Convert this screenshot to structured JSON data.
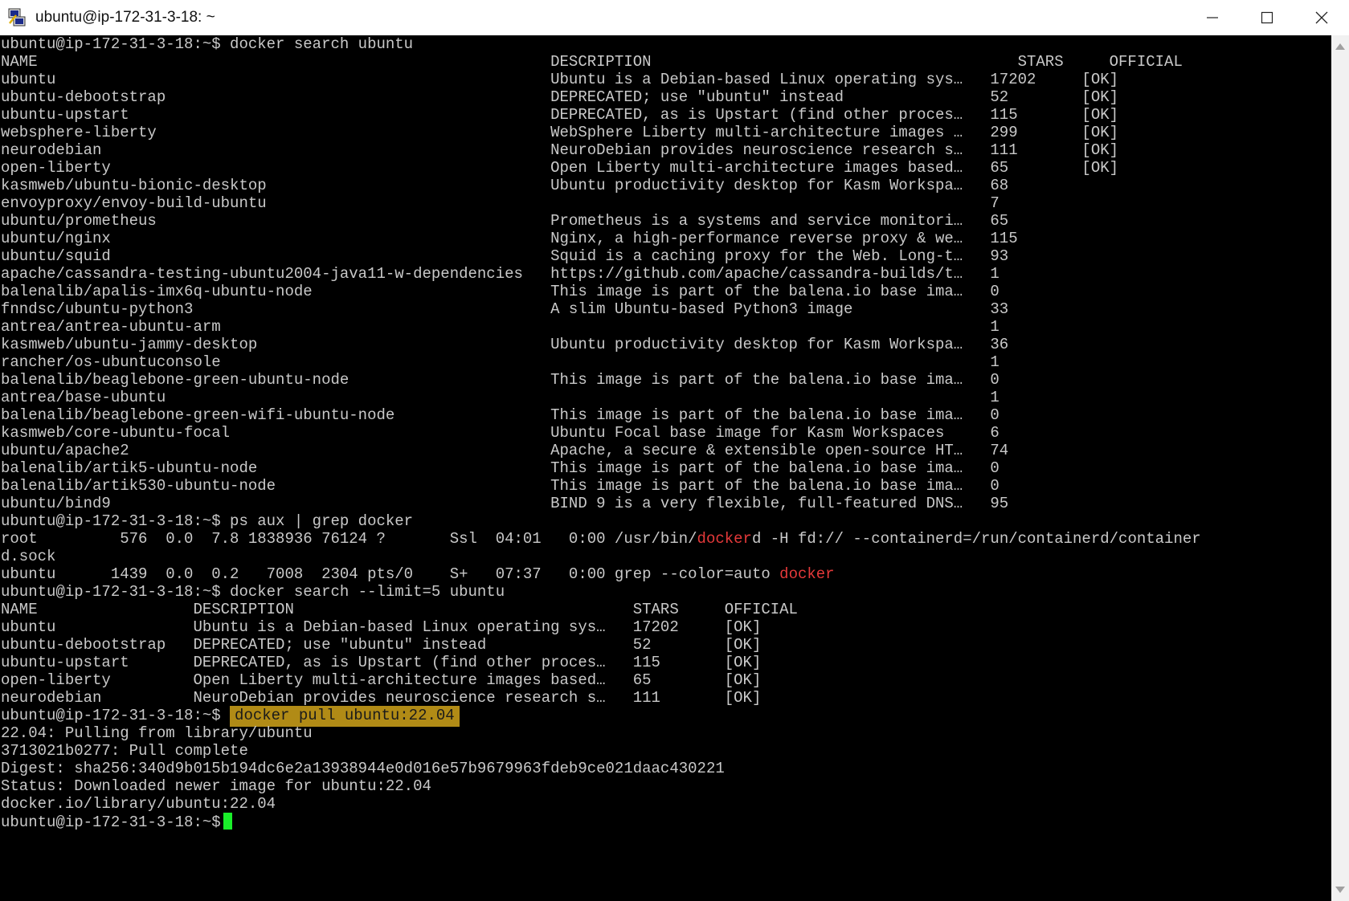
{
  "window": {
    "title": "ubuntu@ip-172-31-3-18: ~"
  },
  "icons": {
    "app": "putty-icon",
    "minimize": "minimize-icon",
    "maximize": "maximize-icon",
    "close": "close-icon"
  },
  "colors": {
    "terminal_bg": "#000000",
    "terminal_fg": "#c9c9c9",
    "match_highlight": "#e5393a",
    "selection_bg": "#b18b16",
    "cursor": "#1aef2a"
  },
  "terminal": {
    "lines": [
      [
        {
          "t": "ubuntu@ip-172-31-3-18:~$ docker search ubuntu"
        }
      ],
      [
        {
          "t": "NAME                                                        DESCRIPTION                                        STARS     OFFICIAL"
        }
      ],
      [
        {
          "t": "ubuntu                                                      Ubuntu is a Debian-based Linux operating sys…   17202     [OK]"
        }
      ],
      [
        {
          "t": "ubuntu-debootstrap                                          DEPRECATED; use \"ubuntu\" instead                52        [OK]"
        }
      ],
      [
        {
          "t": "ubuntu-upstart                                              DEPRECATED, as is Upstart (find other proces…   115       [OK]"
        }
      ],
      [
        {
          "t": "websphere-liberty                                           WebSphere Liberty multi-architecture images …   299       [OK]"
        }
      ],
      [
        {
          "t": "neurodebian                                                 NeuroDebian provides neuroscience research s…   111       [OK]"
        }
      ],
      [
        {
          "t": "open-liberty                                                Open Liberty multi-architecture images based…   65        [OK]"
        }
      ],
      [
        {
          "t": "kasmweb/ubuntu-bionic-desktop                               Ubuntu productivity desktop for Kasm Workspa…   68"
        }
      ],
      [
        {
          "t": "envoyproxy/envoy-build-ubuntu                                                                               7"
        }
      ],
      [
        {
          "t": "ubuntu/prometheus                                           Prometheus is a systems and service monitori…   65"
        }
      ],
      [
        {
          "t": "ubuntu/nginx                                                Nginx, a high-performance reverse proxy & we…   115"
        }
      ],
      [
        {
          "t": "ubuntu/squid                                                Squid is a caching proxy for the Web. Long-t…   93"
        }
      ],
      [
        {
          "t": "apache/cassandra-testing-ubuntu2004-java11-w-dependencies   https://github.com/apache/cassandra-builds/t…   1"
        }
      ],
      [
        {
          "t": "balenalib/apalis-imx6q-ubuntu-node                          This image is part of the balena.io base ima…   0"
        }
      ],
      [
        {
          "t": "fnndsc/ubuntu-python3                                       A slim Ubuntu-based Python3 image               33"
        }
      ],
      [
        {
          "t": "antrea/antrea-ubuntu-arm                                                                                    1"
        }
      ],
      [
        {
          "t": "kasmweb/ubuntu-jammy-desktop                                Ubuntu productivity desktop for Kasm Workspa…   36"
        }
      ],
      [
        {
          "t": "rancher/os-ubuntuconsole                                                                                    1"
        }
      ],
      [
        {
          "t": "balenalib/beaglebone-green-ubuntu-node                      This image is part of the balena.io base ima…   0"
        }
      ],
      [
        {
          "t": "antrea/base-ubuntu                                                                                          1"
        }
      ],
      [
        {
          "t": "balenalib/beaglebone-green-wifi-ubuntu-node                 This image is part of the balena.io base ima…   0"
        }
      ],
      [
        {
          "t": "kasmweb/core-ubuntu-focal                                   Ubuntu Focal base image for Kasm Workspaces     6"
        }
      ],
      [
        {
          "t": "ubuntu/apache2                                              Apache, a secure & extensible open-source HT…   74"
        }
      ],
      [
        {
          "t": "balenalib/artik5-ubuntu-node                                This image is part of the balena.io base ima…   0"
        }
      ],
      [
        {
          "t": "balenalib/artik530-ubuntu-node                              This image is part of the balena.io base ima…   0"
        }
      ],
      [
        {
          "t": "ubuntu/bind9                                                BIND 9 is a very flexible, full-featured DNS…   95"
        }
      ],
      [
        {
          "t": "ubuntu@ip-172-31-3-18:~$ ps aux | grep docker"
        }
      ],
      [
        {
          "t": "root         576  0.0  7.8 1838936 76124 ?       Ssl  04:01   0:00 /usr/bin/"
        },
        {
          "t": "docker",
          "c": "red"
        },
        {
          "t": "d -H fd:// --containerd=/run/containerd/container"
        }
      ],
      [
        {
          "t": "d.sock"
        }
      ],
      [
        {
          "t": "ubuntu      1439  0.0  0.2   7008  2304 pts/0    S+   07:37   0:00 grep --color=auto "
        },
        {
          "t": "docker",
          "c": "red"
        }
      ],
      [
        {
          "t": "ubuntu@ip-172-31-3-18:~$ docker search --limit=5 ubuntu"
        }
      ],
      [
        {
          "t": "NAME                 DESCRIPTION                                     STARS     OFFICIAL"
        }
      ],
      [
        {
          "t": "ubuntu               Ubuntu is a Debian-based Linux operating sys…   17202     [OK]"
        }
      ],
      [
        {
          "t": "ubuntu-debootstrap   DEPRECATED; use \"ubuntu\" instead                52        [OK]"
        }
      ],
      [
        {
          "t": "ubuntu-upstart       DEPRECATED, as is Upstart (find other proces…   115       [OK]"
        }
      ],
      [
        {
          "t": "open-liberty         Open Liberty multi-architecture images based…   65        [OK]"
        }
      ],
      [
        {
          "t": "neurodebian          NeuroDebian provides neuroscience research s…   111       [OK]"
        }
      ],
      [
        {
          "t": "ubuntu@ip-172-31-3-18:~$ "
        },
        {
          "t": "docker pull ubuntu:22.04",
          "c": "sel"
        }
      ],
      [
        {
          "t": "22.04: Pulling from library/ubuntu"
        }
      ],
      [
        {
          "t": "3713021b0277: Pull complete"
        }
      ],
      [
        {
          "t": "Digest: sha256:340d9b015b194dc6e2a13938944e0d016e57b9679963fdeb9ce021daac430221"
        }
      ],
      [
        {
          "t": "Status: Downloaded newer image for ubuntu:22.04"
        }
      ],
      [
        {
          "t": "docker.io/library/ubuntu:22.04"
        }
      ],
      [
        {
          "t": "ubuntu@ip-172-31-3-18:~$"
        },
        {
          "t": "",
          "c": "cursor"
        }
      ]
    ]
  }
}
